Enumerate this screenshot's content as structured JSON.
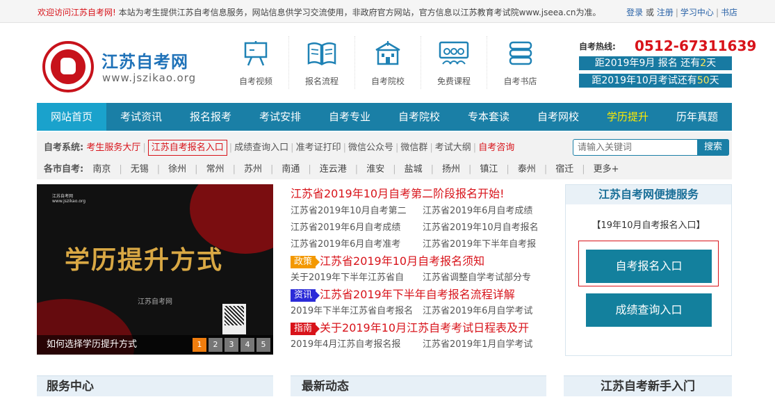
{
  "topbar": {
    "welcome": "欢迎访问江苏自考网!",
    "notice": "本站为考生提供江苏自考信息服务，网站信息供学习交流使用，非政府官方网站，官方信息以江苏教育考试院www.jseea.cn为准。",
    "login": "登录",
    "or": "或",
    "register": "注册",
    "study_center": "学习中心",
    "bookstore": "书店"
  },
  "logo": {
    "title": "江苏自考网",
    "subtitle": "www.jszikao.org"
  },
  "quicknav": [
    {
      "label": "自考视频",
      "icon": "easel-icon"
    },
    {
      "label": "报名流程",
      "icon": "book-icon"
    },
    {
      "label": "自考院校",
      "icon": "school-icon"
    },
    {
      "label": "免费课程",
      "icon": "classroom-icon"
    },
    {
      "label": "自考书店",
      "icon": "books-stack-icon"
    }
  ],
  "hotline": {
    "label": "自考热线:",
    "number": "0512-67311639"
  },
  "countdown": {
    "first": {
      "prefix": "距2019年9月 报名 还有",
      "days": "2",
      "suffix": "天"
    },
    "second": {
      "prefix": "距2019年10月考试还有",
      "days": "50",
      "suffix": "天"
    }
  },
  "mainnav": [
    {
      "label": "网站首页",
      "state": "active"
    },
    {
      "label": "考试资讯",
      "state": ""
    },
    {
      "label": "报名报考",
      "state": ""
    },
    {
      "label": "考试安排",
      "state": ""
    },
    {
      "label": "自考专业",
      "state": ""
    },
    {
      "label": "自考院校",
      "state": ""
    },
    {
      "label": "专本套读",
      "state": ""
    },
    {
      "label": "自考网校",
      "state": ""
    },
    {
      "label": "学历提升",
      "state": "highlight"
    },
    {
      "label": "历年真题",
      "state": ""
    }
  ],
  "system": {
    "label": "自考系统:",
    "links": [
      "考生服务大厅",
      "江苏自考报名入口",
      "成绩查询入口",
      "准考证打印",
      "微信公众号",
      "微信群",
      "考试大纲",
      "自考咨询"
    ]
  },
  "search": {
    "placeholder": "请输入关键词",
    "button": "搜索"
  },
  "cities": {
    "label": "各市自考:",
    "items": [
      "南京",
      "无锡",
      "徐州",
      "常州",
      "苏州",
      "南通",
      "连云港",
      "淮安",
      "盐城",
      "扬州",
      "镇江",
      "泰州",
      "宿迁",
      "更多+"
    ]
  },
  "banner": {
    "logo_text": "江苏自考网",
    "logo_url": "www.jszikao.org",
    "big_text": "学历提升方式",
    "mid_text": "江苏自考网",
    "caption": "如何选择学历提升方式",
    "pages": [
      "1",
      "2",
      "3",
      "4",
      "5"
    ]
  },
  "news": {
    "headline": "江苏省2019年10月自考第二阶段报名开始!",
    "group1": [
      [
        "江苏省2019年10月自考第二",
        "江苏省2019年6月自考成绩"
      ],
      [
        "江苏省2019年6月自考成绩",
        "江苏省2019年10月自考报名"
      ],
      [
        "江苏省2019年6月自考准考",
        "江苏省2019年下半年自考报"
      ]
    ],
    "policy": {
      "tag": "政策",
      "title": "江苏省2019年10月自考报名须知",
      "items": [
        "关于2019年下半年江苏省自",
        "江苏省调整自学考试部分专"
      ]
    },
    "info": {
      "tag": "资讯",
      "title": "江苏省2019年下半年自考报名流程详解",
      "items": [
        "2019年下半年江苏省自考报名",
        "江苏省2019年6月自学考试"
      ]
    },
    "guide": {
      "tag": "指南",
      "title": "关于2019年10月江苏自考考试日程表及开",
      "items": [
        "2019年4月江苏自考报名报",
        "江苏省2019年1月自学考试"
      ]
    }
  },
  "service": {
    "title": "江苏自考网便捷服务",
    "link": "【19年10月自考报名入口】",
    "btn1": "自考报名入口",
    "btn2": "成绩查询入口"
  },
  "bottom_panels": [
    "服务中心",
    "最新动态",
    "江苏自考新手入门"
  ]
}
